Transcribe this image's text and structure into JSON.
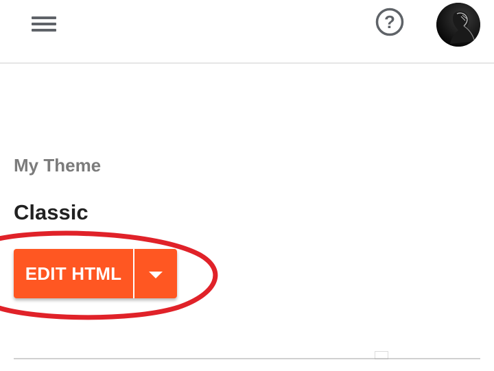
{
  "header": {
    "menu_icon": "hamburger-menu-icon",
    "help_icon": "help-circle-icon",
    "help_glyph": "?",
    "avatar_icon": "user-avatar"
  },
  "theme": {
    "section_label": "My Theme",
    "name": "Classic"
  },
  "actions": {
    "edit_html_label": "EDIT HTML",
    "dropdown_icon": "caret-down-icon"
  },
  "annotation": {
    "color": "#e02229",
    "shape": "ellipse-highlight"
  },
  "colors": {
    "accent": "#ff5722",
    "header_border": "#e6e6e6",
    "label_gray": "#7b7b7b",
    "title_dark": "#212121",
    "icon_gray": "#5f6368"
  }
}
